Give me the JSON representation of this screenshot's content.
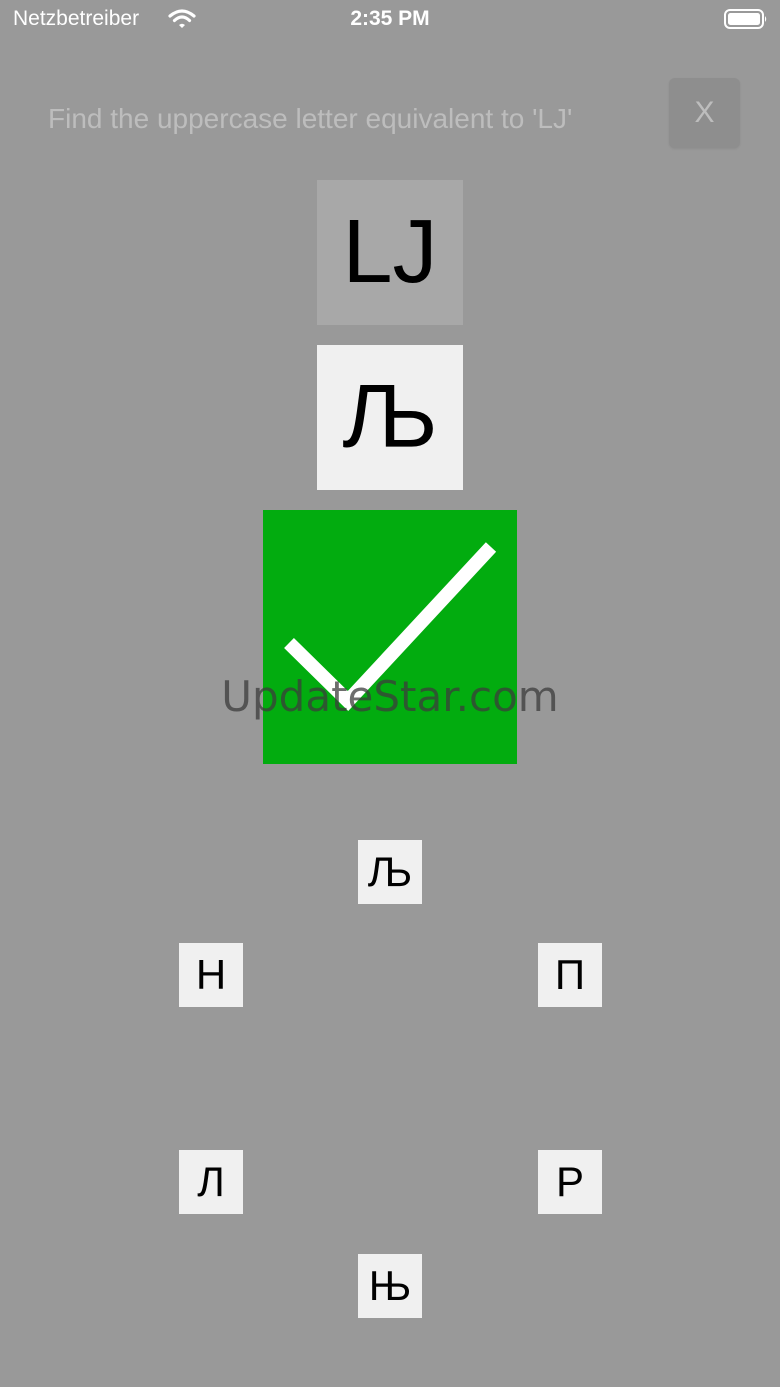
{
  "status_bar": {
    "carrier": "Netzbetreiber",
    "time": "2:35 PM",
    "wifi_icon": "wifi-icon",
    "battery_icon": "battery-icon"
  },
  "quiz": {
    "prompt": "Find the uppercase letter equivalent to 'LJ'",
    "close_label": "X",
    "target_letter": "LJ",
    "selected_answer": "Љ",
    "result": "correct",
    "result_icon": "checkmark-icon",
    "result_color": "#02ac0f"
  },
  "choices": {
    "top": "Љ",
    "upper_left": "Н",
    "upper_right": "П",
    "lower_left": "Л",
    "lower_right": "Р",
    "bottom": "Њ"
  },
  "watermark": "UpdateStar.com"
}
